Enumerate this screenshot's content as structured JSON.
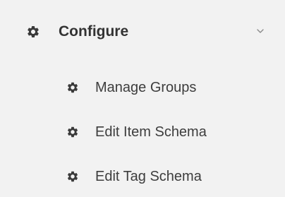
{
  "configure_menu": {
    "label": "Configure",
    "icon": "gear-icon",
    "expand_icon": "chevron-down-icon",
    "items": [
      {
        "label": "Manage Groups",
        "icon": "gear-icon"
      },
      {
        "label": "Edit Item Schema",
        "icon": "gear-icon"
      },
      {
        "label": "Edit Tag Schema",
        "icon": "gear-icon"
      }
    ]
  },
  "colors": {
    "background": "#f2f2f2",
    "text": "#333333",
    "icon": "#3a3a3a",
    "chevron": "#8a8a8a"
  }
}
